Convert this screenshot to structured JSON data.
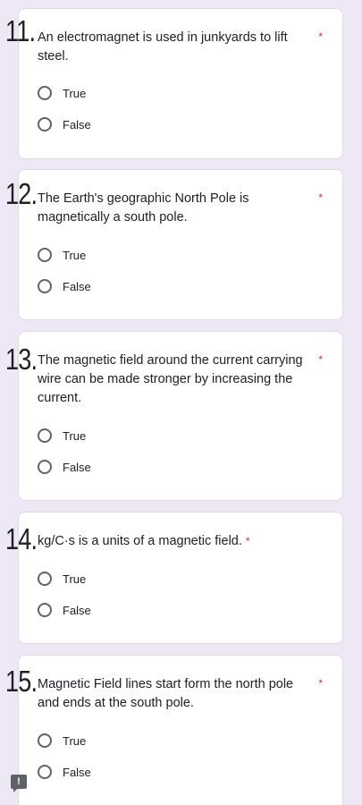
{
  "questions": [
    {
      "number": "11.",
      "text": "An electromagnet is used in junkyards to lift steel.",
      "required_mark": "*",
      "options": [
        "True",
        "False"
      ]
    },
    {
      "number": "12.",
      "text": "The Earth's geographic North Pole is magnetically a south pole.",
      "required_mark": "*",
      "options": [
        "True",
        "False"
      ]
    },
    {
      "number": "13.",
      "text": "The magnetic field around the current carrying wire can be made stronger by increasing the current.",
      "required_mark": "*",
      "options": [
        "True",
        "False"
      ]
    },
    {
      "number": "14.",
      "text": "kg/C·s is a units of a magnetic field.",
      "required_mark": "*",
      "options": [
        "True",
        "False"
      ]
    },
    {
      "number": "15.",
      "text": "Magnetic Field lines start form the north pole and ends at the south pole.",
      "required_mark": "*",
      "options": [
        "True",
        "False"
      ]
    }
  ],
  "feedback_icon": "feedback-icon",
  "colors": {
    "background": "#ede7f6",
    "required": "#d93025",
    "radio_border": "#5f6368"
  }
}
